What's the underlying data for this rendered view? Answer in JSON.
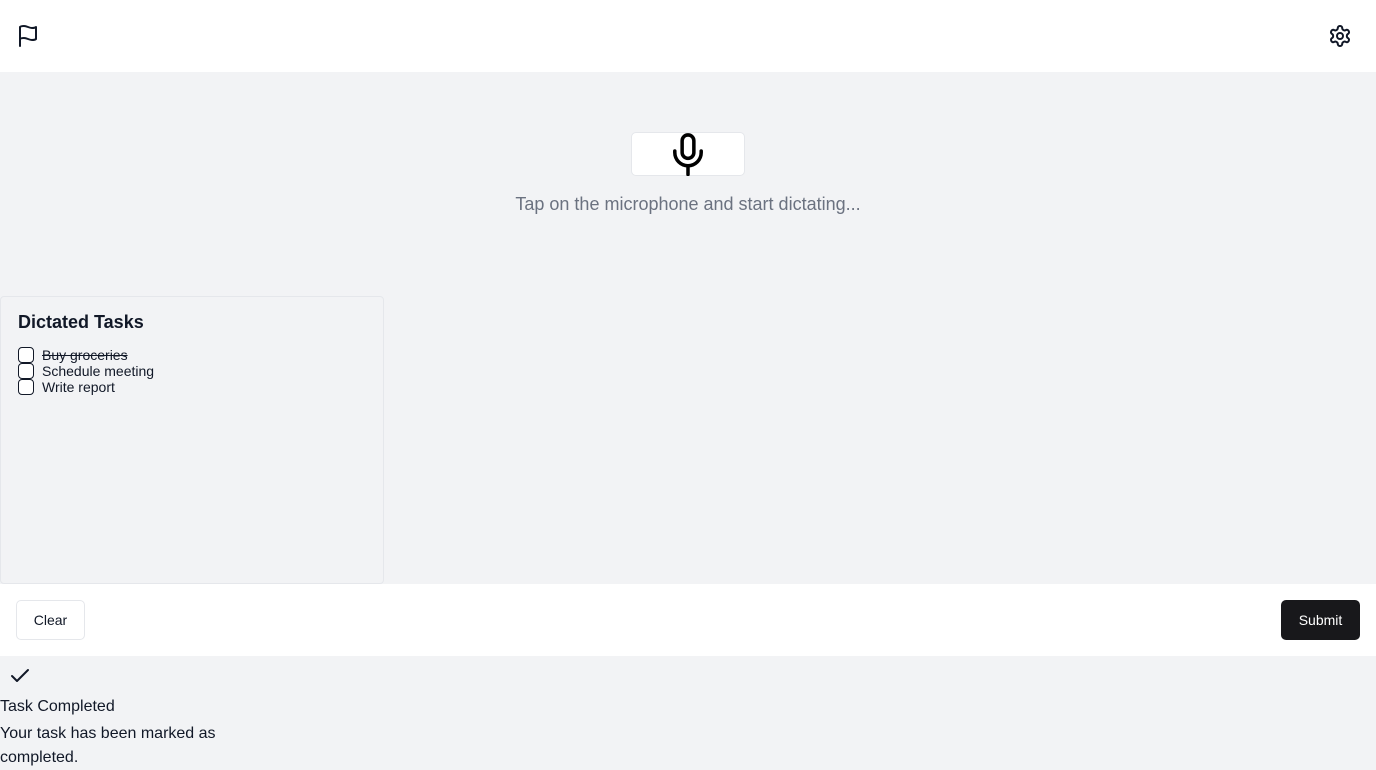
{
  "header": {
    "left_icon": "flag-icon",
    "right_icon": "gear-icon"
  },
  "dictation": {
    "mic_icon": "microphone-icon",
    "hint": "Tap on the microphone and start dictating..."
  },
  "tasks": {
    "title": "Dictated Tasks",
    "items": [
      {
        "label": "Buy groceries",
        "checked": false,
        "completed": true
      },
      {
        "label": "Schedule meeting",
        "checked": false,
        "completed": false
      },
      {
        "label": "Write report",
        "checked": false,
        "completed": false
      }
    ]
  },
  "footer": {
    "clear_label": "Clear",
    "submit_label": "Submit"
  },
  "toast": {
    "icon": "check-icon",
    "title": "Task Completed",
    "description": "Your task has been marked as completed."
  },
  "colors": {
    "page_bg": "#f2f3f5",
    "surface": "#ffffff",
    "primary_button": "#18181b",
    "muted_text": "#6b7280"
  }
}
